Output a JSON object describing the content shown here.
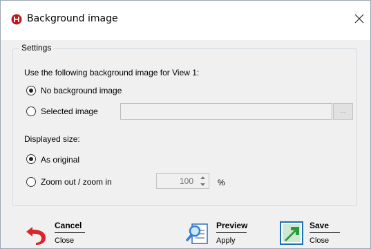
{
  "dialog": {
    "title": "Background image",
    "close_glyph": "✕"
  },
  "settings": {
    "group_label": "Settings",
    "intro_text": "Use the following background image for View 1:",
    "option_none": "No background image",
    "option_selected": "Selected image",
    "selected_path": "",
    "browse_label": "...",
    "size_heading": "Displayed size:",
    "size_original": "As original",
    "size_zoom": "Zoom out / zoom in",
    "zoom_value": "100",
    "zoom_unit": "%",
    "background_choice": "No background image",
    "size_choice": "As original"
  },
  "buttons": {
    "cancel": {
      "label": "Cancel",
      "sub": "Close",
      "icon": "undo-arrow-icon"
    },
    "preview": {
      "label": "Preview",
      "sub": "Apply",
      "icon": "preview-magnifier-icon"
    },
    "save": {
      "label": "Save",
      "sub": "Close",
      "icon": "save-arrow-icon"
    }
  },
  "colors": {
    "app_icon": "#c0171c",
    "cancel_icon": "#d7262b",
    "preview_icon": "#2f7ed8",
    "save_icon": "#2b9a3a",
    "save_icon_bg": "#1a6fb5"
  }
}
